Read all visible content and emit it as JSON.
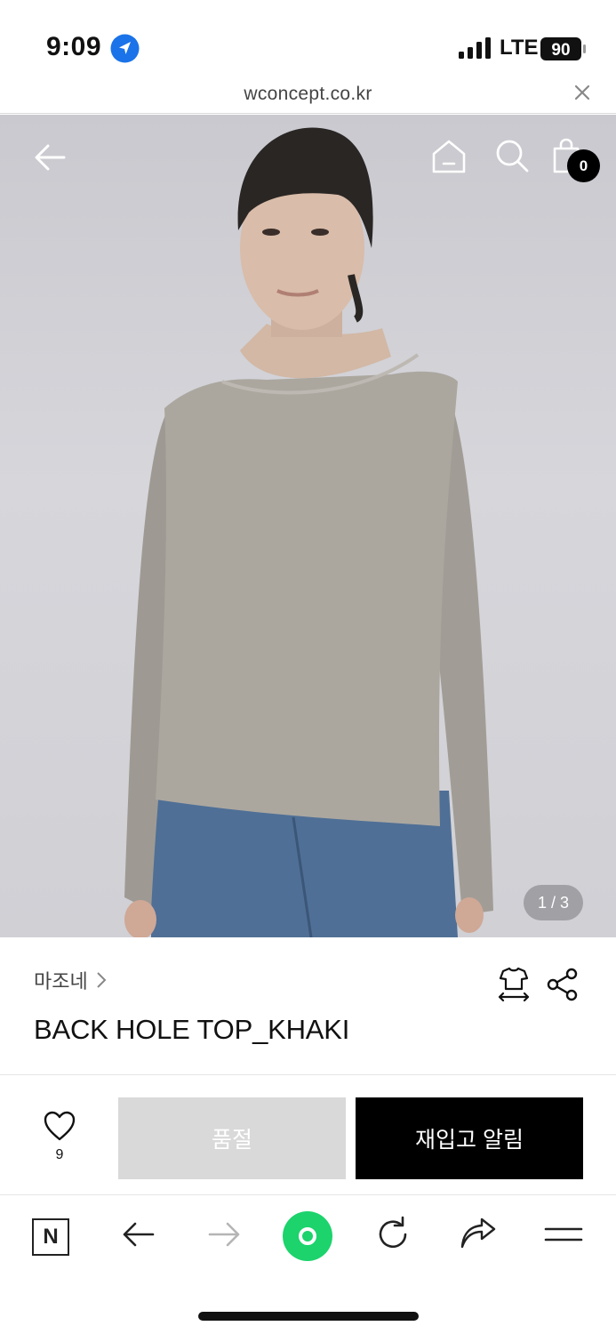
{
  "status_bar": {
    "time": "9:09",
    "network": "LTE",
    "battery": "90",
    "icons": [
      "location-arrow-icon",
      "signal-icon",
      "battery-icon"
    ]
  },
  "url_bar": {
    "url": "wconcept.co.kr"
  },
  "hero": {
    "image_counter": "1 / 3",
    "cart_count": "0",
    "icons": [
      "back-arrow-icon",
      "home-icon",
      "search-icon",
      "shopping-bag-icon"
    ]
  },
  "product": {
    "brand": "마조네",
    "title": "BACK HOLE TOP_KHAKI"
  },
  "actions": {
    "like_count": "9",
    "soldout_label": "품절",
    "restock_label": "재입고 알림"
  },
  "toolbar": {
    "naver_label": "N",
    "icons": [
      "naver-icon",
      "back-icon",
      "forward-icon",
      "green-dot-icon",
      "reload-icon",
      "share-arrow-icon",
      "menu-icon"
    ]
  },
  "colors": {
    "accent_green": "#1cd36c",
    "soldout_bg": "#d9d9d9",
    "restock_bg": "#000000",
    "location_blue": "#1a73e8"
  }
}
